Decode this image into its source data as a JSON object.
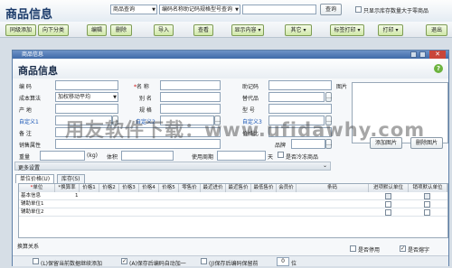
{
  "app": {
    "title": "商品信息"
  },
  "search": {
    "field_select": "商品查询",
    "mode_select": "编码名称助记码规格型号查询",
    "query_value": "",
    "query_button": "查询",
    "stock_filter_label": "只显示库存数量大于零商品"
  },
  "toolbar": {
    "buttons": [
      "同级添加",
      "向下分类",
      "编辑",
      "删除",
      "导入",
      "查看",
      "显示内容",
      "其它",
      "标签打印",
      "打印",
      "退出"
    ]
  },
  "dialog": {
    "window_title": "商品信息",
    "header_title": "商品信息",
    "fields": {
      "code": "编 码",
      "name": "名 称",
      "mnemonic": "助记码",
      "image": "图片",
      "cost_method": "成本算法",
      "cost_method_value": "加权移动平均",
      "alias": "别 名",
      "substitute": "替代品",
      "origin": "产 地",
      "spec": "规 格",
      "model": "型 号",
      "custom1": "自定义1",
      "custom2": "自定义2",
      "custom3": "自定义3",
      "remark": "备 注",
      "price_scale": "价格比",
      "sales_attr": "销售属性",
      "brand": "品牌",
      "weight": "重量",
      "weight_unit": "(kg)",
      "volume": "体积",
      "shelf_life": "使用周期",
      "shelf_unit": "天",
      "frozen_label": "是否冷冻商品"
    },
    "add_image_button": "添加图片",
    "delete_image_button": "删除图片",
    "more_settings": "更多设置",
    "tabs": [
      "单位价格(U)",
      "库存(S)"
    ],
    "table": {
      "headers": [
        "单位",
        "*换算率",
        "价格1",
        "价格2",
        "价格3",
        "价格4",
        "价格5",
        "零售价",
        "最近进价",
        "最近售价",
        "最低售价",
        "会员价",
        "条码",
        "进项默认单位",
        "销项默认单位"
      ],
      "rows": [
        "基本信息",
        "辅助单位1",
        "辅助单位2"
      ],
      "base_rate": "1"
    },
    "convert_label": "换算关系",
    "disable_label": "是否停用",
    "clear_zero_label": "是否熔字",
    "footer": {
      "keep_label": "(L)保留当前数据继续添加",
      "auto_add_label": "(A)保存后编码自动加一",
      "code_prefix_label": "(J)保存后编码保留前",
      "code_prefix_value": "0",
      "code_prefix_unit": "位"
    }
  },
  "watermark": "用友软件下载：www.ufidawhy.com"
}
